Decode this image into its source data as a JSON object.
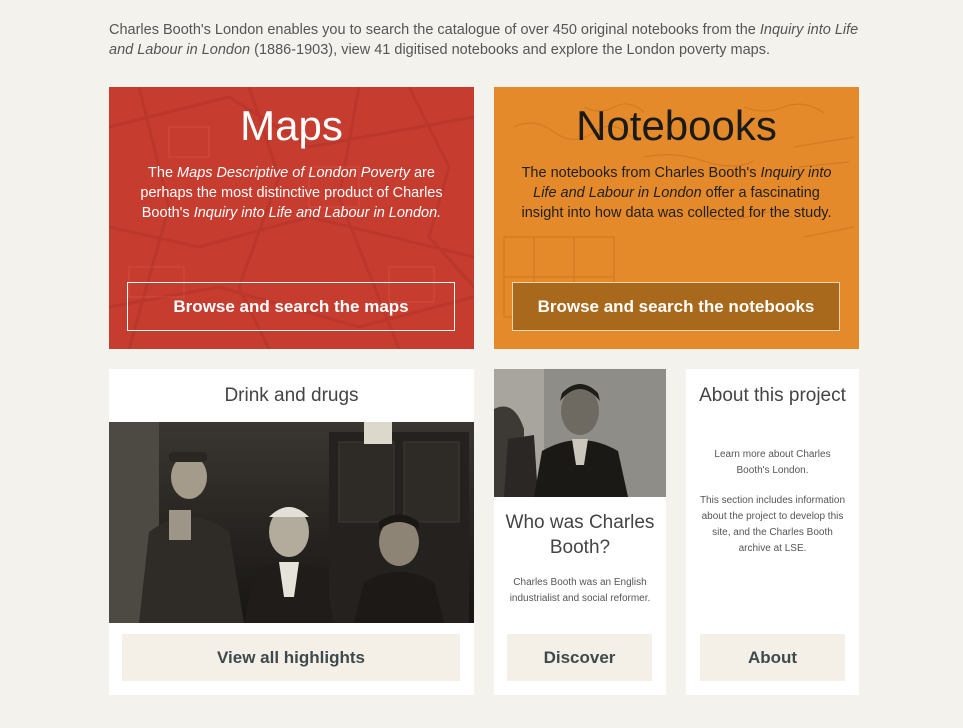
{
  "intro": {
    "text_a": "Charles Booth's London enables you to search the catalogue of over 450 original notebooks from the ",
    "text_em": "Inquiry into Life and Labour in London",
    "text_b": " (1886-1903), view 41 digitised notebooks and explore the London poverty maps."
  },
  "maps": {
    "title": "Maps",
    "desc_a": "The ",
    "desc_em1": "Maps Descriptive of London Poverty",
    "desc_b": " are perhaps the most distinctive product of Charles Booth's ",
    "desc_em2": "Inquiry into Life and Labour in London.",
    "button": "Browse and search the maps",
    "bg_color": "#c63d30"
  },
  "notebooks": {
    "title": "Notebooks",
    "desc_a": "The notebooks from Charles Booth's ",
    "desc_em": "Inquiry into Life and Labour in London",
    "desc_b": " offer a fascinating insight into how data was collected for the study.",
    "button": "Browse and search the notebooks",
    "bg_color": "#e48a2a"
  },
  "drink": {
    "title": "Drink and drugs",
    "button": "View all highlights"
  },
  "who": {
    "title": "Who was Charles Booth?",
    "desc": "Charles Booth was an English industrialist and social reformer.",
    "button": "Discover"
  },
  "about": {
    "title": "About this project",
    "desc1": "Learn more about Charles Booth's London.",
    "desc2": "This section includes information about the project to develop this site, and the Charles Booth archive at LSE.",
    "button": "About"
  }
}
